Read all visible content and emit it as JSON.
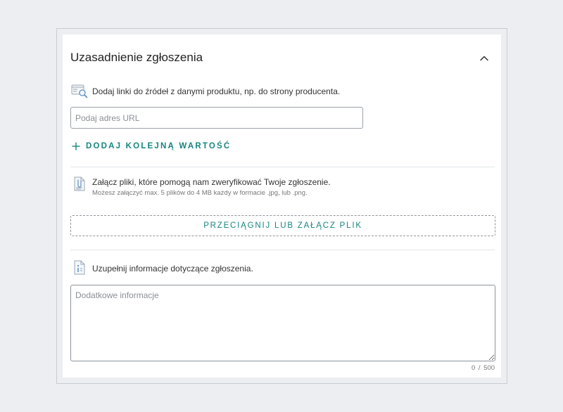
{
  "section": {
    "title": "Uzasadnienie zgłoszenia"
  },
  "links": {
    "description": "Dodaj linki do źródeł z danymi produktu, np. do strony producenta.",
    "url_placeholder": "Podaj adres URL",
    "url_value": "",
    "add_button_label": "DODAJ KOLEJNĄ WARTOŚĆ"
  },
  "files": {
    "description": "Załącz pliki, które pomogą nam zweryfikować Twoje zgłoszenie.",
    "hint": "Możesz załączyć max. 5 plików do 4 MB każdy w formacie .jpg, lub .png.",
    "dropzone_label": "PRZECIĄGNIJ LUB ZAŁĄCZ PLIK"
  },
  "info": {
    "description": "Uzupełnij informacje dotyczące zgłoszenia.",
    "textarea_placeholder": "Dodatkowe informacje",
    "char_counter": "0 / 500"
  },
  "colors": {
    "accent": "#16857f",
    "page_background": "#eceef1",
    "card_background": "#ffffff",
    "border": "#8e949a"
  },
  "icons": {
    "collapse": "chevron-up-icon",
    "link_search": "link-search-icon",
    "attachment": "attachment-document-icon",
    "info": "info-document-icon",
    "add": "plus-icon"
  }
}
